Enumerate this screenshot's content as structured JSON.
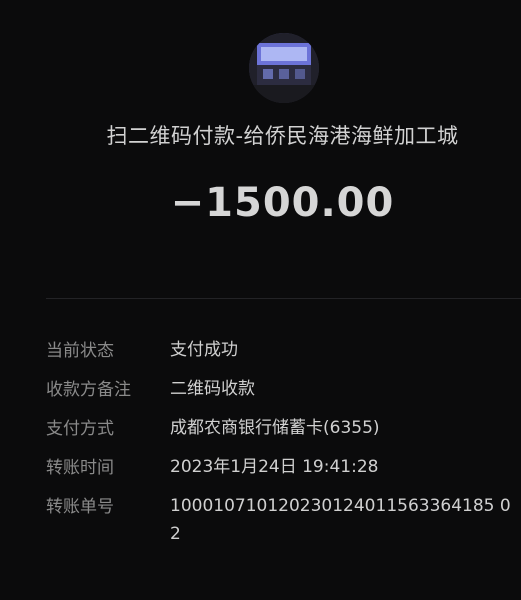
{
  "header": {
    "merchant_title": "扫二维码付款-给侨民海港海鲜加工城",
    "amount": "−1500.00"
  },
  "details": [
    {
      "label": "当前状态",
      "value": "支付成功"
    },
    {
      "label": "收款方备注",
      "value": "二维码收款"
    },
    {
      "label": "支付方式",
      "value": "成都农商银行储蓄卡(6355)"
    },
    {
      "label": "转账时间",
      "value": "2023年1月24日 19:41:28"
    },
    {
      "label": "转账单号",
      "value": "100010710120230124011563364185 02"
    }
  ]
}
